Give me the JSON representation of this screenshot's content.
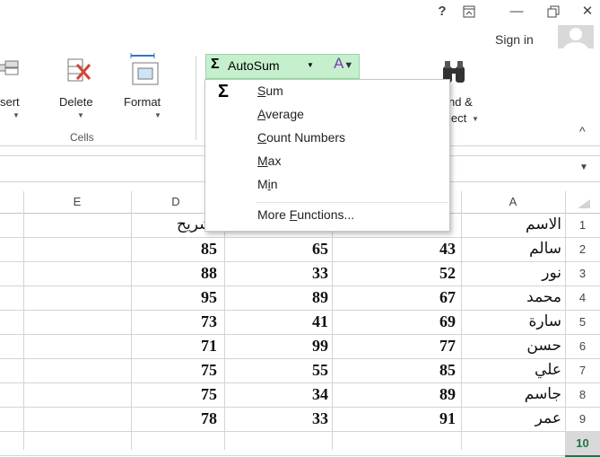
{
  "titlebar": {
    "help": "?",
    "restore_ribbon": "⊼",
    "minimize": "—",
    "maximize": "🗗",
    "close": "✕",
    "sign_in": "Sign in"
  },
  "ribbon": {
    "insert_label": "sert",
    "delete_label": "Delete",
    "format_label": "Format",
    "cells_group": "Cells",
    "autosum_label": "AutoSum",
    "find_label_1": "nd &",
    "find_label_2": "lect",
    "collapse": "^"
  },
  "autosum_menu": {
    "items": [
      {
        "pre": "",
        "ul": "S",
        "post": "um"
      },
      {
        "pre": "",
        "ul": "A",
        "post": "verage"
      },
      {
        "pre": "",
        "ul": "C",
        "post": "ount Numbers"
      },
      {
        "pre": "",
        "ul": "M",
        "post": "ax"
      },
      {
        "pre": "M",
        "ul": "i",
        "post": "n"
      },
      {
        "pre": "More ",
        "ul": "F",
        "post": "unctions..."
      }
    ]
  },
  "columns": [
    "E",
    "D",
    "C",
    "B",
    "A"
  ],
  "rows": [
    {
      "n": "1",
      "d": "تشريح",
      "c": "",
      "b": "",
      "a": "الاسم"
    },
    {
      "n": "2",
      "d": "85",
      "c": "65",
      "b": "43",
      "a": "سالم"
    },
    {
      "n": "3",
      "d": "88",
      "c": "33",
      "b": "52",
      "a": "نور"
    },
    {
      "n": "4",
      "d": "95",
      "c": "89",
      "b": "67",
      "a": "محمد"
    },
    {
      "n": "5",
      "d": "73",
      "c": "41",
      "b": "69",
      "a": "سارة"
    },
    {
      "n": "6",
      "d": "71",
      "c": "99",
      "b": "77",
      "a": "حسن"
    },
    {
      "n": "7",
      "d": "75",
      "c": "55",
      "b": "85",
      "a": "علي"
    },
    {
      "n": "8",
      "d": "75",
      "c": "34",
      "b": "89",
      "a": "جاسم"
    },
    {
      "n": "9",
      "d": "78",
      "c": "33",
      "b": "91",
      "a": "عمر"
    },
    {
      "n": "10",
      "d": "",
      "c": "",
      "b": "",
      "a": ""
    }
  ]
}
